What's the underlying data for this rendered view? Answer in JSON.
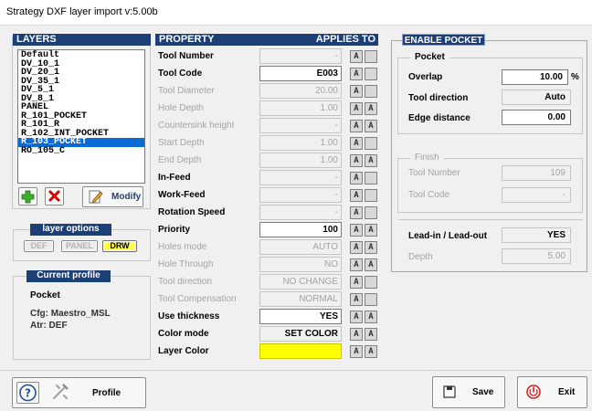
{
  "window": {
    "title": "Strategy DXF layer import v:5.00b"
  },
  "layers": {
    "header": "LAYERS",
    "items": [
      "Default",
      "DV_10_1",
      "DV_20_1",
      "DV_35_1",
      "DV_5_1",
      "DV_8_1",
      "PANEL",
      "R_101_POCKET",
      "R_101_R",
      "R_102_INT_POCKET",
      "R_103_POCKET",
      "RO_105_C"
    ],
    "selected": "R_103_POCKET",
    "modify_label": "Modify"
  },
  "layer_options": {
    "title": "layer options",
    "def": "DEF",
    "panel": "PANEL",
    "drw": "DRW"
  },
  "current_profile": {
    "title": "Current profile",
    "name": "Pocket",
    "cfg": "Cfg:  Maestro_MSL",
    "atr": "Atr:  DEF"
  },
  "property": {
    "header": "PROPERTY",
    "applies_to": "APPLIES TO",
    "rows": [
      {
        "label": "Tool Number",
        "value": "-",
        "enabled": true,
        "field_enabled": false,
        "icon2": "blank",
        "color": ""
      },
      {
        "label": "Tool Code",
        "value": "E003",
        "enabled": true,
        "field_enabled": true,
        "icon2": "blank",
        "color": ""
      },
      {
        "label": "Tool Diameter",
        "value": "20.00",
        "enabled": false,
        "field_enabled": false,
        "icon2": "blank",
        "color": ""
      },
      {
        "label": "Hole Depth",
        "value": "1.00",
        "enabled": false,
        "field_enabled": false,
        "icon2": "a",
        "color": ""
      },
      {
        "label": "Countersink height",
        "value": "-",
        "enabled": false,
        "field_enabled": false,
        "icon2": "a",
        "color": ""
      },
      {
        "label": "Start Depth",
        "value": "1.00",
        "enabled": false,
        "field_enabled": false,
        "icon2": "blank",
        "color": ""
      },
      {
        "label": "End Depth",
        "value": "1.00",
        "enabled": false,
        "field_enabled": false,
        "icon2": "a",
        "color": ""
      },
      {
        "label": "In-Feed",
        "value": "-",
        "enabled": true,
        "field_enabled": false,
        "icon2": "blank",
        "color": ""
      },
      {
        "label": "Work-Feed",
        "value": "-",
        "enabled": true,
        "field_enabled": false,
        "icon2": "blank",
        "color": ""
      },
      {
        "label": "Rotation Speed",
        "value": "-",
        "enabled": true,
        "field_enabled": false,
        "icon2": "blank",
        "color": ""
      },
      {
        "label": "Priority",
        "value": "100",
        "enabled": true,
        "field_enabled": true,
        "icon2": "a",
        "color": ""
      },
      {
        "label": "Holes mode",
        "value": "AUTO",
        "enabled": false,
        "field_enabled": false,
        "icon2": "a",
        "color": ""
      },
      {
        "label": "Hole Through",
        "value": "NO",
        "enabled": false,
        "field_enabled": false,
        "icon2": "a",
        "color": ""
      },
      {
        "label": "Tool direction",
        "value": "NO CHANGE",
        "enabled": false,
        "field_enabled": false,
        "icon2": "blank",
        "color": ""
      },
      {
        "label": "Tool Compensation",
        "value": "NORMAL",
        "enabled": false,
        "field_enabled": false,
        "icon2": "blank",
        "color": ""
      },
      {
        "label": "Use thickness",
        "value": "YES",
        "enabled": true,
        "field_enabled": true,
        "icon2": "a",
        "color": ""
      },
      {
        "label": "Color mode",
        "value": "SET COLOR",
        "enabled": true,
        "field_enabled": false,
        "icon2": "a",
        "color": "",
        "bold_value": true
      },
      {
        "label": "Layer Color",
        "value": "",
        "enabled": true,
        "field_enabled": true,
        "icon2": "a",
        "color": "#ffff00"
      }
    ]
  },
  "enable_pocket": {
    "header": "ENABLE POCKET",
    "pocket": {
      "title": "Pocket",
      "overlap_label": "Overlap",
      "overlap_value": "10.00",
      "overlap_unit": "%",
      "direction_label": "Tool direction",
      "direction_value": "Auto",
      "edge_label": "Edge distance",
      "edge_value": "0.00"
    },
    "finish": {
      "title": "Finish",
      "tool_number_label": "Tool Number",
      "tool_number_value": "109",
      "tool_code_label": "Tool Code",
      "tool_code_value": "-"
    },
    "lead": {
      "label": "Lead-in / Lead-out",
      "value": "YES",
      "depth_label": "Depth",
      "depth_value": "5.00"
    }
  },
  "bottom": {
    "profile_label": "Profile",
    "save_label": "Save",
    "exit_label": "Exit"
  },
  "colors": {
    "header_bg": "#1d3f77",
    "selection": "#0a6ad3",
    "yellow": "#ffff00"
  }
}
